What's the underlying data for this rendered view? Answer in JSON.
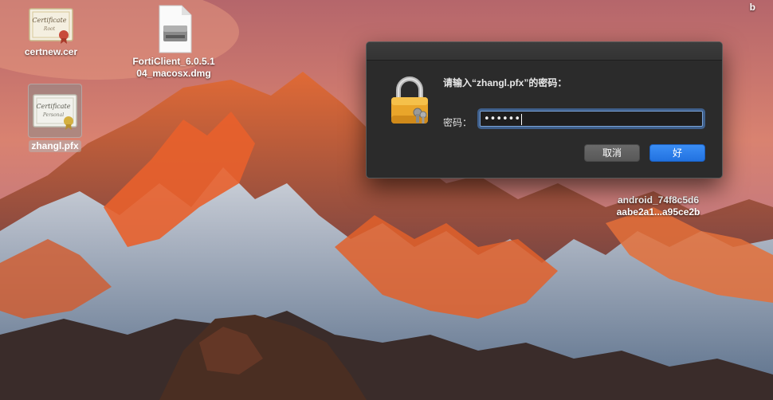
{
  "desktop": {
    "icons": [
      {
        "label": "certnew.cer",
        "icon": "certificate-icon",
        "cert_title": "Certificate",
        "cert_sub": "Root"
      },
      {
        "label": "FortiClient_6.0.5.1\n04_macosx.dmg",
        "icon": "disk-image-icon"
      },
      {
        "label": "zhangl.pfx",
        "icon": "certificate-icon",
        "cert_title": "Certificate",
        "cert_sub": "Personal"
      },
      {
        "label": "android_74f8c5d6\naabe2a1...a95ce2b",
        "icon": "file-icon"
      }
    ],
    "top_right_fragment": "b"
  },
  "dialog": {
    "message": "请输入“zhangl.pfx”的密码：",
    "password_label": "密码：",
    "password_value": "••••••",
    "cancel_label": "取消",
    "ok_label": "好",
    "lock_icon": "lock-keys-icon"
  },
  "colors": {
    "accent": "#2272e0",
    "dialog_bg": "#2b2b2b",
    "focus_ring": "#508cdc"
  }
}
